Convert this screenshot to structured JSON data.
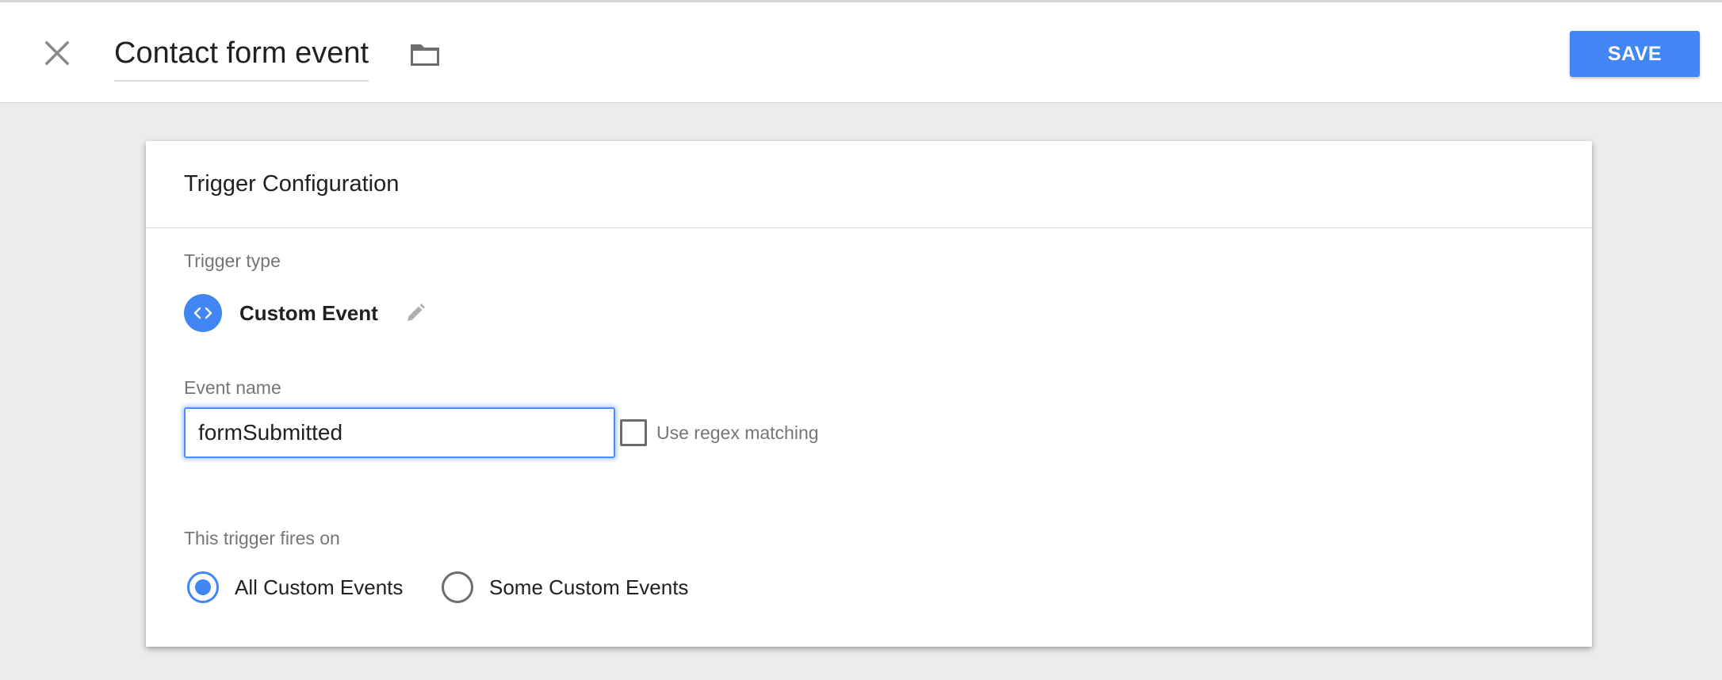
{
  "header": {
    "close_icon": "close-icon",
    "title": "Contact form event",
    "folder_icon": "folder-icon",
    "save_label": "SAVE"
  },
  "card": {
    "title": "Trigger Configuration",
    "trigger_type": {
      "label": "Trigger type",
      "icon": "code-brackets-icon",
      "value": "Custom Event",
      "edit_icon": "pencil-icon"
    },
    "event_name": {
      "label": "Event name",
      "value": "formSubmitted",
      "regex_label": "Use regex matching",
      "regex_checked": false
    },
    "fires_on": {
      "label": "This trigger fires on",
      "options": [
        {
          "label": "All Custom Events",
          "selected": true
        },
        {
          "label": "Some Custom Events",
          "selected": false
        }
      ]
    }
  },
  "colors": {
    "accent": "#4285f4",
    "background": "#ececec",
    "text_primary": "#212121",
    "text_secondary": "#757575"
  }
}
